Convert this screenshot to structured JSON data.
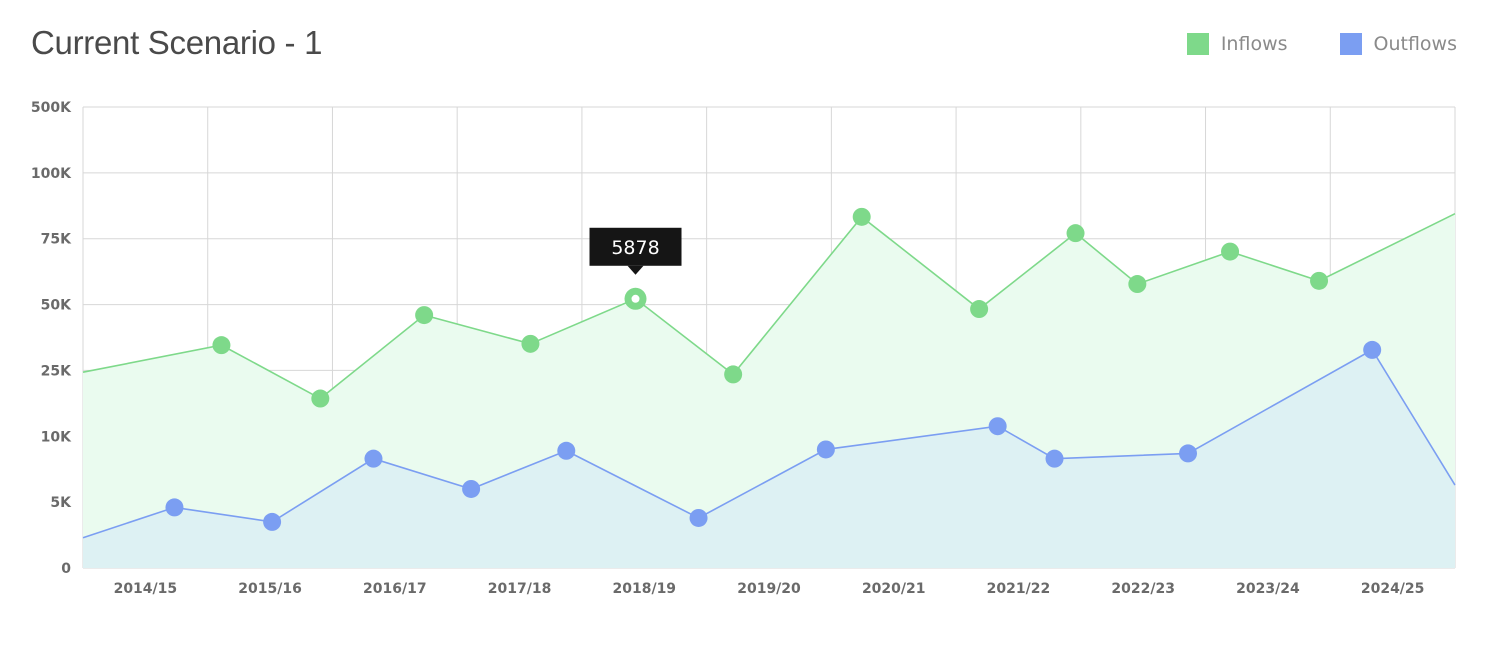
{
  "title": "Current Scenario - 1",
  "legend": [
    {
      "label": "Inflows",
      "color": "#7ed98a"
    },
    {
      "label": "Outflows",
      "color": "#7b9ef2"
    }
  ],
  "tooltip": {
    "value": "5878",
    "series": "Inflows",
    "point_index": 5
  },
  "chart_data": {
    "type": "area",
    "title": "Current Scenario - 1",
    "y_tick_labels": [
      "0",
      "5K",
      "10K",
      "25K",
      "50K",
      "75K",
      "100K",
      "500K"
    ],
    "x_tick_labels": [
      "2014/15",
      "2015/16",
      "2016/17",
      "2017/18",
      "2018/19",
      "2019/20",
      "2020/21",
      "2021/22",
      "2022/23",
      "2023/24",
      "2024/25"
    ],
    "grid": true,
    "legend_position": "top-right",
    "series": [
      {
        "name": "Inflows",
        "color": "#7ed98a",
        "fill": "#eafbef",
        "points": [
          {
            "x": 0.0,
            "y": 24.6,
            "marker": false
          },
          {
            "x": 1.12,
            "y": 34.6,
            "marker": true
          },
          {
            "x": 1.92,
            "y": 18.6,
            "marker": true
          },
          {
            "x": 2.76,
            "y": 46.0,
            "marker": true
          },
          {
            "x": 3.62,
            "y": 35.1,
            "marker": true
          },
          {
            "x": 4.47,
            "y": 52.2,
            "marker": true
          },
          {
            "x": 5.26,
            "y": 24.1,
            "marker": true
          },
          {
            "x": 6.3,
            "y": 83.3,
            "marker": true
          },
          {
            "x": 7.25,
            "y": 48.3,
            "marker": true
          },
          {
            "x": 8.03,
            "y": 77.1,
            "marker": true
          },
          {
            "x": 8.53,
            "y": 57.8,
            "marker": true
          },
          {
            "x": 9.28,
            "y": 70.1,
            "marker": true
          },
          {
            "x": 10.0,
            "y": 59.0,
            "marker": true
          },
          {
            "x": 11.1,
            "y": 84.5,
            "marker": false
          }
        ]
      },
      {
        "name": "Outflows",
        "color": "#7b9ef2",
        "fill": "#dcf0f3",
        "points": [
          {
            "x": 0.0,
            "y": 2.3,
            "marker": false
          },
          {
            "x": 0.74,
            "y": 4.6,
            "marker": true
          },
          {
            "x": 1.53,
            "y": 3.5,
            "marker": true
          },
          {
            "x": 2.35,
            "y": 8.3,
            "marker": true
          },
          {
            "x": 3.14,
            "y": 6.0,
            "marker": true
          },
          {
            "x": 3.91,
            "y": 8.9,
            "marker": true
          },
          {
            "x": 4.98,
            "y": 3.8,
            "marker": true
          },
          {
            "x": 6.01,
            "y": 9.0,
            "marker": true
          },
          {
            "x": 7.4,
            "y": 12.3,
            "marker": true
          },
          {
            "x": 7.86,
            "y": 8.3,
            "marker": true
          },
          {
            "x": 8.94,
            "y": 8.7,
            "marker": true
          },
          {
            "x": 10.43,
            "y": 32.8,
            "marker": true
          },
          {
            "x": 11.1,
            "y": 6.3,
            "marker": false
          }
        ]
      }
    ]
  }
}
